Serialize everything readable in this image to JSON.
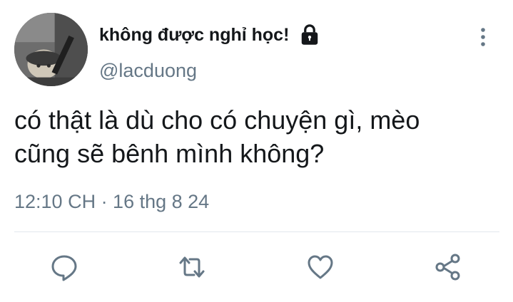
{
  "tweet": {
    "display_name": "không được nghỉ học!",
    "handle": "@lacduong",
    "text_lines": [
      "có thật là dù cho có chuyện gì, mèo",
      "cũng sẽ bênh mình không?"
    ],
    "timestamp": "12:10 CH · 16 thg 8 24",
    "protected": true
  },
  "icons": {
    "avatar": "avatar-photo-icon",
    "lock": "lock-icon",
    "more": "more-vertical-icon",
    "reply": "reply-icon",
    "retweet": "retweet-icon",
    "like": "heart-icon",
    "share": "share-icon"
  },
  "colors": {
    "text_primary": "#14171a",
    "text_secondary": "#657786",
    "action_icons": "#657786",
    "divider": "#e1e8ed"
  }
}
